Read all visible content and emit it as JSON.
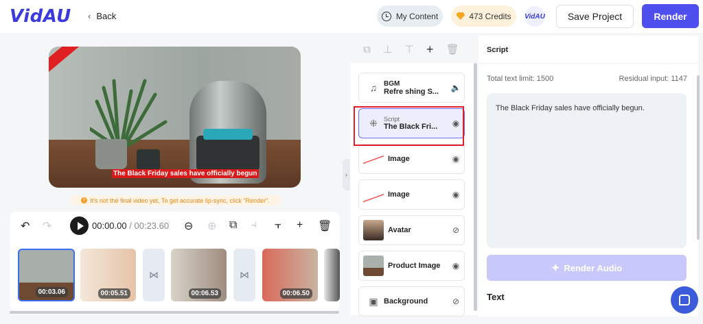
{
  "app": {
    "logo": "VidAU",
    "back_label": "Back"
  },
  "header": {
    "my_content": "My Content",
    "credits": "473 Credits",
    "badge": "VidAU",
    "save_label": "Save Project",
    "render_label": "Render",
    "accent": "#4f4ff0"
  },
  "preview": {
    "subtitle": "The Black Friday sales have officially begun",
    "warning": "It's not the final video yet, To get accurate lip-sync, click \"Render\"."
  },
  "timeline": {
    "current_time": "00:00.00",
    "separator": "/",
    "total_time": "00:23.60",
    "clips": [
      {
        "duration": "00:03.06",
        "selected": true
      },
      {
        "duration": "00:05.51",
        "selected": false
      },
      {
        "duration": "00:06.53",
        "selected": false
      },
      {
        "duration": "00:06.50",
        "selected": false
      }
    ]
  },
  "layers": [
    {
      "title": "BGM",
      "name": "Refre shing S...",
      "icon": "music-icon",
      "visibility": "volume-icon"
    },
    {
      "title": "Script",
      "name": "The Black Fri...",
      "icon": "script-icon",
      "visibility": "eye-icon",
      "selected": true
    },
    {
      "title": "",
      "name": "Image",
      "icon": "image-thumb",
      "visibility": "eye-icon"
    },
    {
      "title": "",
      "name": "Image",
      "icon": "image-thumb",
      "visibility": "eye-icon"
    },
    {
      "title": "",
      "name": "Avatar",
      "icon": "avatar-thumb",
      "visibility": "eye-off-icon"
    },
    {
      "title": "",
      "name": "Product Image",
      "icon": "product-thumb",
      "visibility": "eye-icon"
    },
    {
      "title": "",
      "name": "Background",
      "icon": "background-icon",
      "visibility": "eye-off-icon"
    }
  ],
  "script_panel": {
    "title": "Script",
    "limit": "Total text limit: 1500",
    "residual": "Residual input: 1147",
    "content": "The Black Friday sales have officially begun.",
    "render_audio": "Render Audio",
    "text_section": "Text"
  }
}
